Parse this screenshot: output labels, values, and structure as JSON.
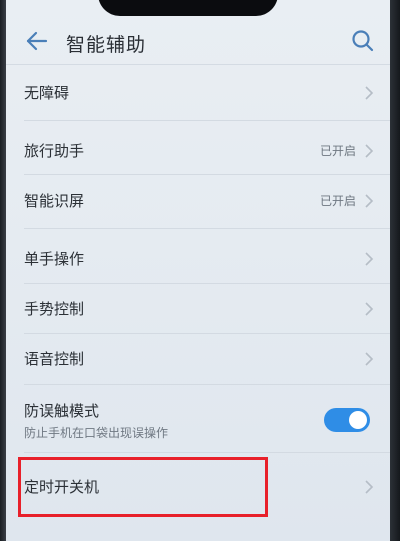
{
  "header": {
    "title": "智能辅助"
  },
  "icons": {
    "back": "back-arrow-icon",
    "search": "search-icon",
    "chevron": "chevron-right-icon"
  },
  "colors": {
    "accent": "#2f8de6",
    "highlight": "#e8202a"
  },
  "settings": {
    "items": [
      {
        "label": "无障碍",
        "status": ""
      },
      {
        "label": "旅行助手",
        "status": "已开启"
      },
      {
        "label": "智能识屏",
        "status": "已开启"
      },
      {
        "label": "单手操作",
        "status": ""
      },
      {
        "label": "手势控制",
        "status": ""
      },
      {
        "label": "语音控制",
        "status": ""
      },
      {
        "label": "防误触模式",
        "description": "防止手机在口袋出现误操作",
        "toggle_on": true
      },
      {
        "label": "定时开关机",
        "status": "",
        "highlighted": true
      }
    ]
  }
}
